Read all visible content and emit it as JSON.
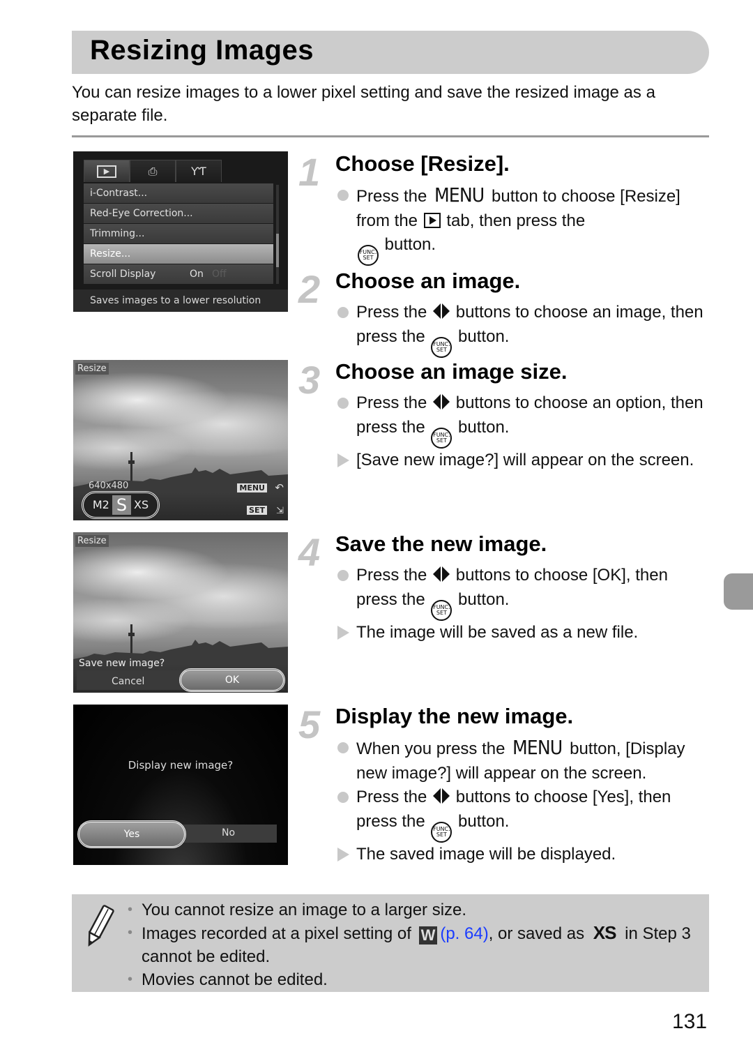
{
  "page": {
    "title": "Resizing Images",
    "intro": "You can resize images to a lower pixel setting and save the resized image as a separate file.",
    "page_number": "131"
  },
  "screens": {
    "menu": {
      "tabs": [
        "play-tab",
        "print-tab",
        "settings-tab"
      ],
      "items": [
        {
          "label": "i-Contrast..."
        },
        {
          "label": "Red-Eye Correction..."
        },
        {
          "label": "Trimming..."
        },
        {
          "label": "Resize..."
        },
        {
          "label": "Scroll Display",
          "value_on": "On",
          "value_off": "Off"
        }
      ],
      "selected_index": 3,
      "hint": "Saves images to a lower resolution"
    },
    "size_select": {
      "label": "Resize",
      "resolution": "640x480",
      "options": [
        "M2",
        "S",
        "XS"
      ],
      "selected": "S",
      "menu_button": "MENU",
      "set_button": "SET"
    },
    "save_dialog": {
      "label": "Resize",
      "prompt": "Save new image?",
      "cancel": "Cancel",
      "ok": "OK"
    },
    "display_dialog": {
      "prompt": "Display new image?",
      "yes": "Yes",
      "no": "No"
    }
  },
  "steps": [
    {
      "number": "1",
      "title": "Choose [Resize].",
      "bullets": [
        {
          "type": "action",
          "parts": [
            "Press the ",
            "MENU",
            " button to choose [Resize] from the ",
            " tab, then press the ",
            " button."
          ]
        }
      ]
    },
    {
      "number": "2",
      "title": "Choose an image.",
      "bullets": [
        {
          "type": "action",
          "parts": [
            "Press the ",
            " buttons to choose an image, then press the ",
            " button."
          ]
        }
      ]
    },
    {
      "number": "3",
      "title": "Choose an image size.",
      "bullets": [
        {
          "type": "action",
          "parts": [
            "Press the ",
            " buttons to choose an option, then press the ",
            " button."
          ]
        },
        {
          "type": "result",
          "text": "[Save new image?] will appear on the screen."
        }
      ]
    },
    {
      "number": "4",
      "title": "Save the new image.",
      "bullets": [
        {
          "type": "action",
          "parts": [
            "Press the ",
            " buttons to choose [OK], then press the ",
            " button."
          ]
        },
        {
          "type": "result",
          "text": "The image will be saved as a new file."
        }
      ]
    },
    {
      "number": "5",
      "title": "Display the new image.",
      "bullets": [
        {
          "type": "action",
          "parts": [
            "When you press the ",
            "MENU",
            " button, [Display new image?] will appear on the screen."
          ]
        },
        {
          "type": "action",
          "parts": [
            "Press the ",
            " buttons to choose [Yes], then press the ",
            " button."
          ]
        },
        {
          "type": "result",
          "text": "The saved image will be displayed."
        }
      ]
    }
  ],
  "icons": {
    "func_top": "FUNC.",
    "func_bottom": "SET",
    "w_icon": "W",
    "xs_icon": "XS"
  },
  "notes": {
    "items": [
      {
        "text": "You cannot resize an image to a larger size."
      },
      {
        "parts": [
          "Images recorded at a pixel setting of ",
          "(p. 64)",
          ", or saved as ",
          " in Step 3 cannot be edited."
        ]
      },
      {
        "text": "Movies cannot be edited."
      }
    ]
  },
  "colors": {
    "title_bar": "#cccccc",
    "notes_bg": "#cccccc",
    "step_number": "#c4c4c4",
    "link": "#1a3cff",
    "side_tab": "#9a9a9a"
  }
}
